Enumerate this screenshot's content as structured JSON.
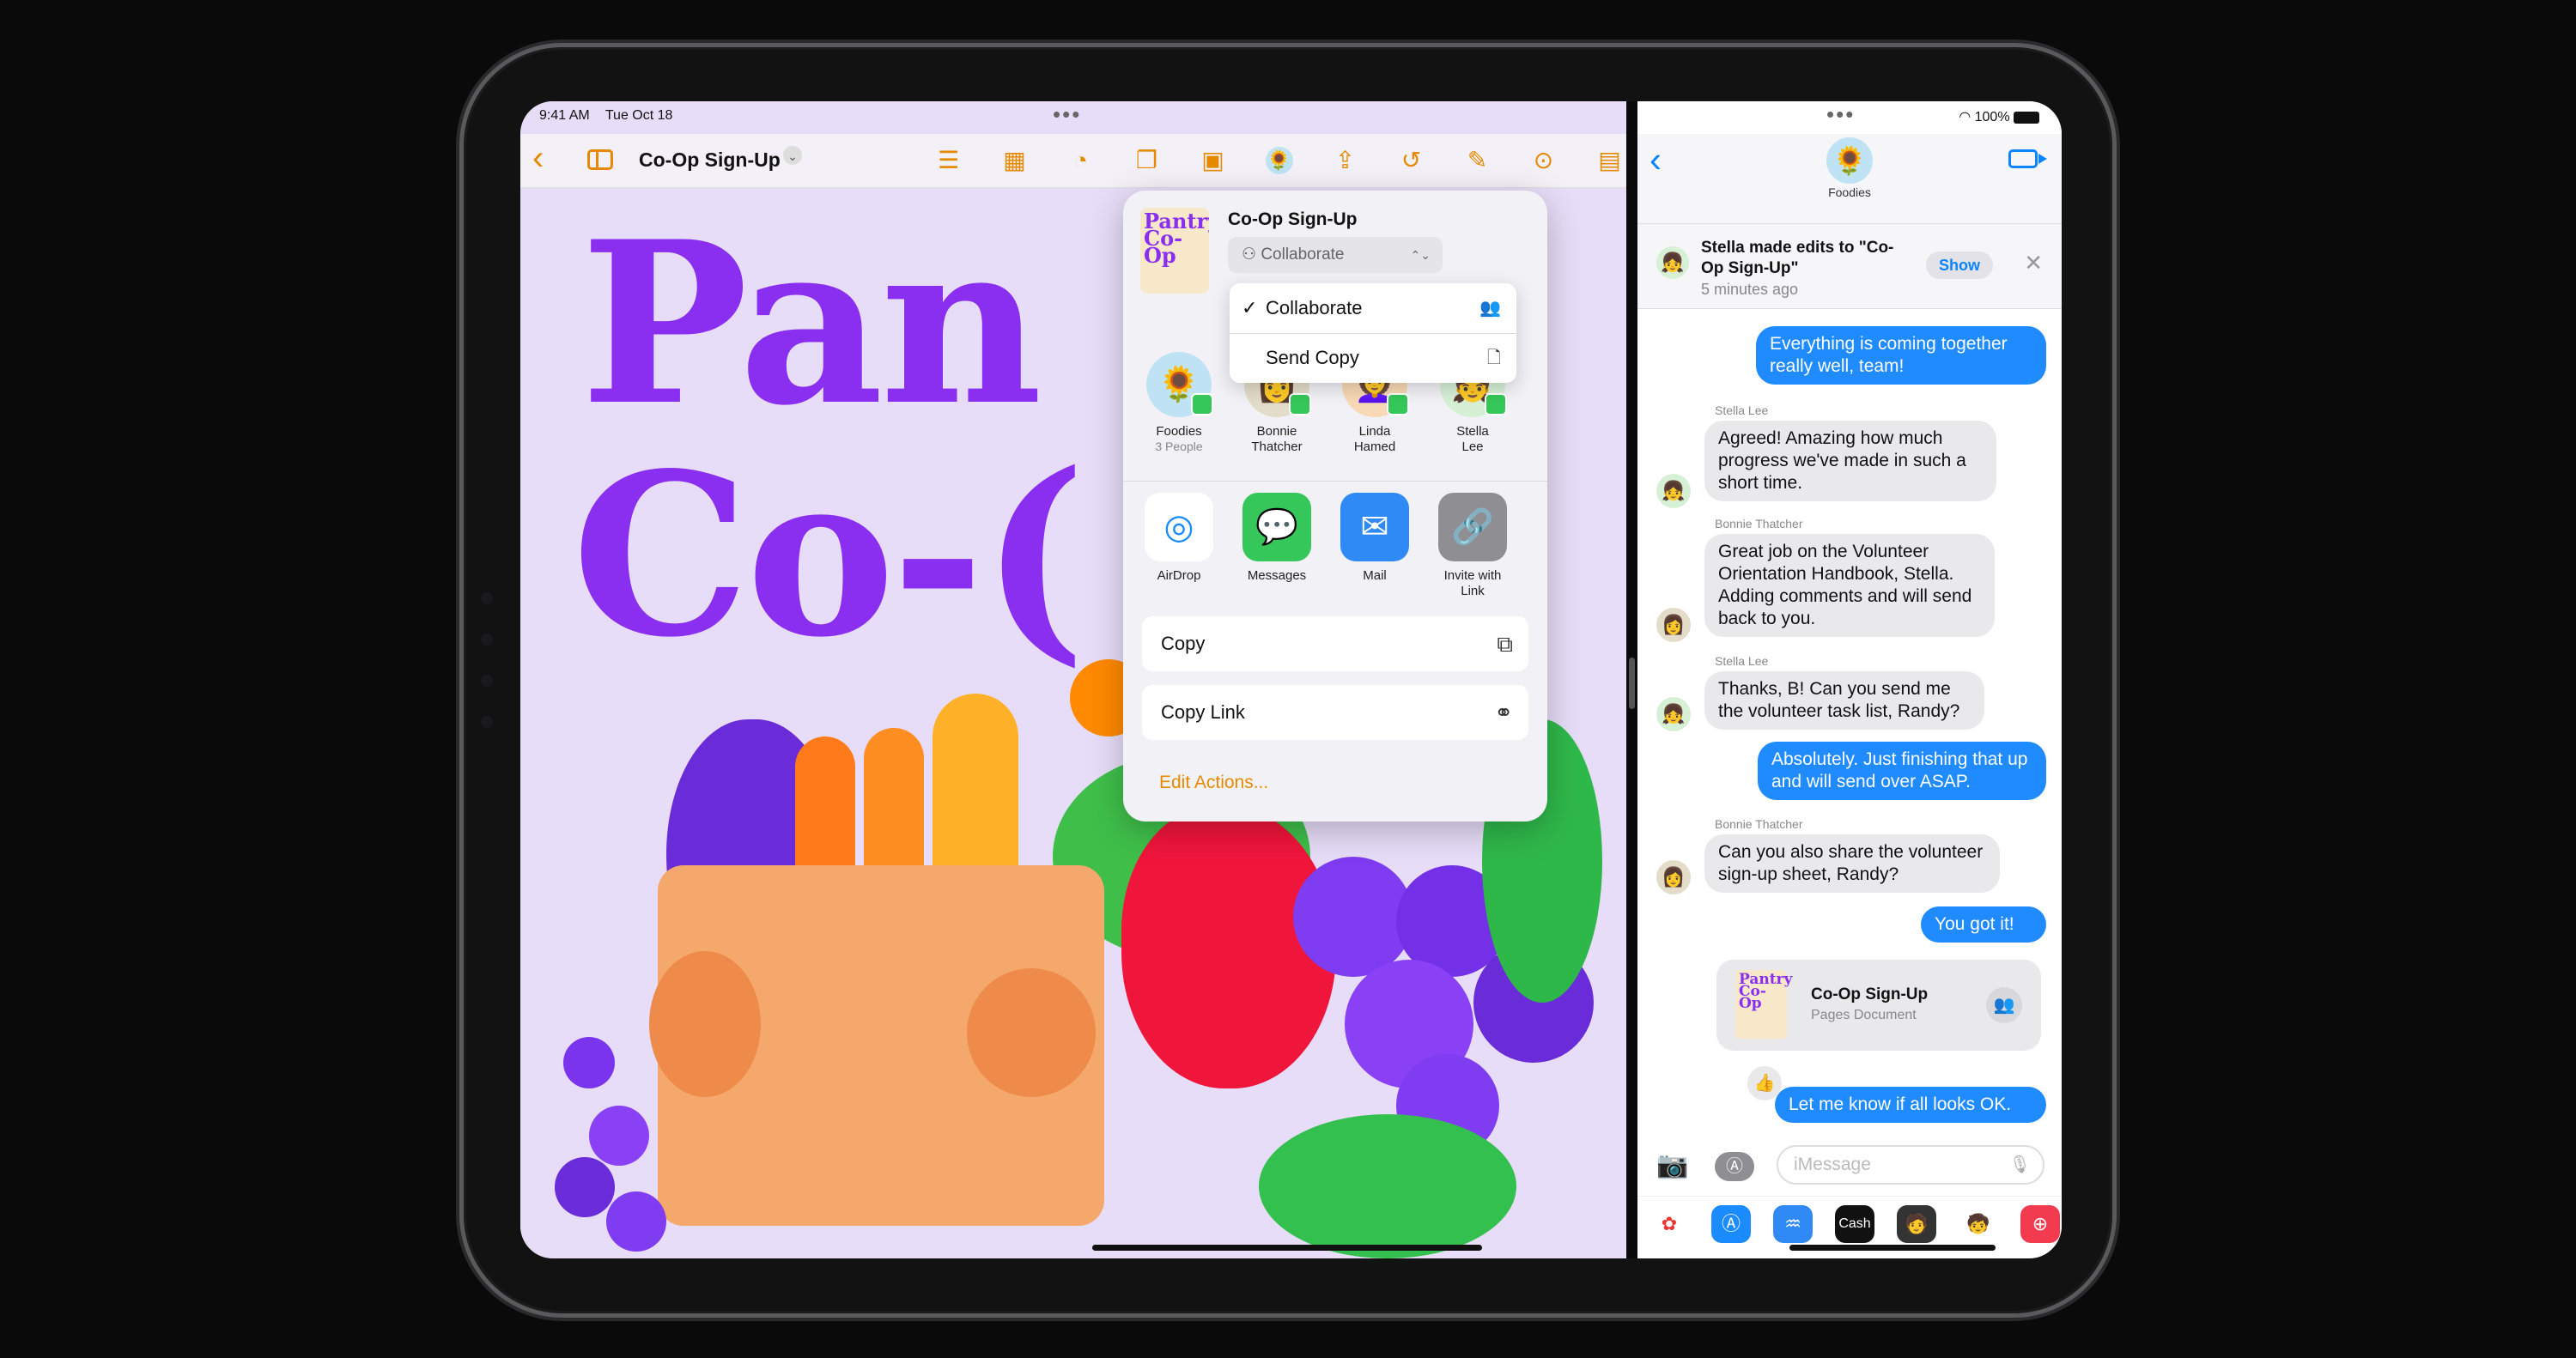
{
  "status_left": {
    "time": "9:41 AM",
    "date": "Tue Oct 18"
  },
  "status_right": {
    "battery": "100%"
  },
  "pages": {
    "doc_title": "Co-Op Sign-Up",
    "poster_line1": "Pan",
    "poster_line2": "Co-("
  },
  "share_sheet": {
    "title": "Co-Op Sign-Up",
    "thumb_text": "Pantry Co-Op",
    "mode_selected": "Collaborate",
    "dropdown": [
      {
        "label": "Collaborate",
        "checked": true,
        "icon": "people-icon"
      },
      {
        "label": "Send Copy",
        "checked": false,
        "icon": "document-icon"
      }
    ],
    "people": [
      {
        "name": "Foodies",
        "sub": "3 People"
      },
      {
        "name": "Bonnie Thatcher",
        "sub": ""
      },
      {
        "name": "Linda Hamed",
        "sub": ""
      },
      {
        "name": "Stella Lee",
        "sub": ""
      }
    ],
    "apps": [
      {
        "label": "AirDrop",
        "color": "#1a8cff"
      },
      {
        "label": "Messages",
        "color": "#35c759"
      },
      {
        "label": "Mail",
        "color": "#2f8af5"
      },
      {
        "label": "Invite with Link",
        "color": "#8e8e93"
      }
    ],
    "actions": [
      {
        "label": "Copy"
      },
      {
        "label": "Copy Link"
      }
    ],
    "edit_actions": "Edit Actions..."
  },
  "messages": {
    "group_name": "Foodies",
    "notification": {
      "title": "Stella made edits to \"Co-Op Sign-Up\"",
      "time": "5 minutes ago",
      "show_label": "Show"
    },
    "thread": [
      {
        "from": "me",
        "text": "Everything is coming together really well, team!"
      },
      {
        "from": "Stella Lee",
        "text": "Agreed! Amazing how much progress we've made in such a short time."
      },
      {
        "from": "Bonnie Thatcher",
        "text": "Great job on the Volunteer Orientation Handbook, Stella. Adding comments and will send back to you."
      },
      {
        "from": "Stella Lee",
        "text": "Thanks, B! Can you send me the volunteer task list, Randy?"
      },
      {
        "from": "me",
        "text": "Absolutely. Just finishing that up and will send over ASAP."
      },
      {
        "from": "Bonnie Thatcher",
        "text": "Can you also share the volunteer sign-up sheet, Randy?"
      },
      {
        "from": "me",
        "text": "You got it!"
      },
      {
        "from": "me",
        "text": "Let me know if all looks OK."
      }
    ],
    "doc_card": {
      "title": "Co-Op Sign-Up",
      "subtitle": "Pages Document",
      "thumb_text": "Pantry Co-Op"
    },
    "input_placeholder": "iMessage",
    "cash_label": "Cash"
  }
}
